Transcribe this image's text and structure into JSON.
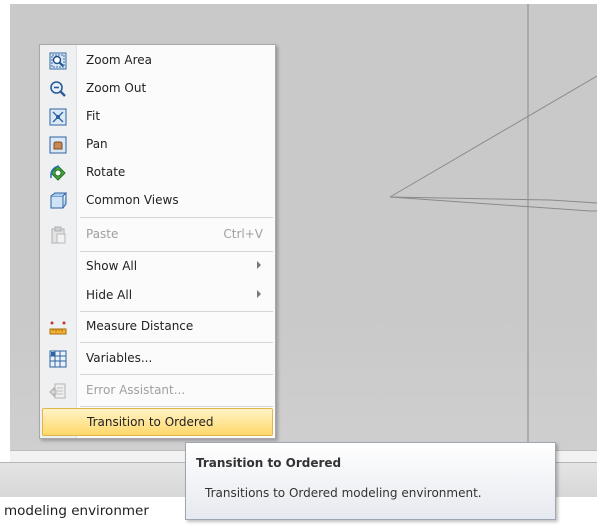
{
  "context_menu": {
    "items": [
      {
        "label": "Zoom Area",
        "icon": "zoom-area-icon"
      },
      {
        "label": "Zoom Out",
        "icon": "zoom-out-icon"
      },
      {
        "label": "Fit",
        "icon": "fit-icon"
      },
      {
        "label": "Pan",
        "icon": "pan-icon"
      },
      {
        "label": "Rotate",
        "icon": "rotate-icon"
      },
      {
        "label": "Common Views",
        "icon": "common-views-icon"
      },
      {
        "label": "Paste",
        "shortcut": "Ctrl+V",
        "icon": "paste-icon",
        "enabled": false
      },
      {
        "label": "Show All",
        "submenu": true
      },
      {
        "label": "Hide All",
        "submenu": true
      },
      {
        "label": "Measure Distance",
        "icon": "measure-distance-icon"
      },
      {
        "label": "Variables...",
        "icon": "variables-icon"
      },
      {
        "label": "Error Assistant...",
        "icon": "error-assistant-icon",
        "enabled": false
      },
      {
        "label": "Transition to Ordered",
        "highlighted": true
      }
    ]
  },
  "tooltip": {
    "title": "Transition to Ordered",
    "description": "Transitions to Ordered modeling environment."
  },
  "prompt_bar": {
    "text": "modeling environmer"
  },
  "colors": {
    "highlight_top": "#fff3c6",
    "highlight_bottom": "#ffd86b",
    "viewport_bg": "#c9c9c9"
  }
}
